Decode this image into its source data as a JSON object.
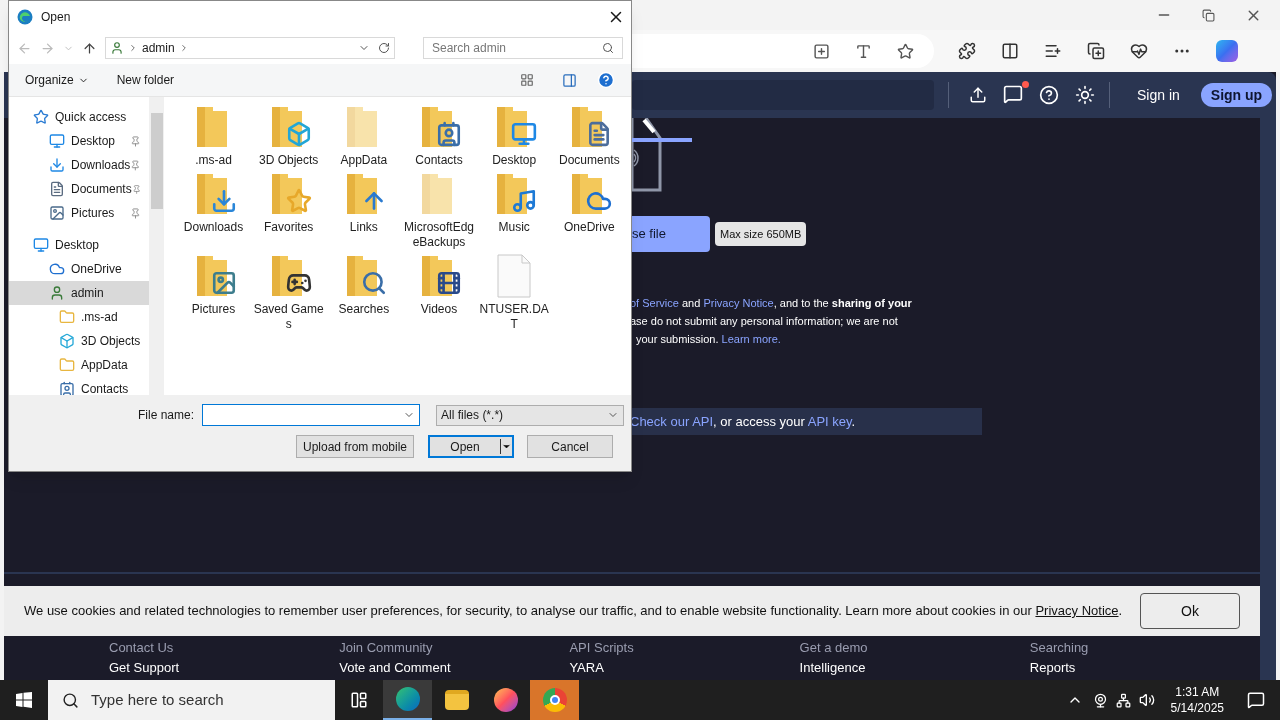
{
  "site": {
    "header": {
      "sign_in": "Sign in",
      "sign_up": "Sign up",
      "notification": true
    },
    "upload_button": "se file",
    "tooltip": "Max size 650MB",
    "terms_lines": [
      [
        {
          "kind": "link",
          "text": "of Service"
        },
        {
          "kind": "text",
          "text": " and "
        },
        {
          "kind": "link",
          "text": "Privacy Notice"
        },
        {
          "kind": "text",
          "text": ", and to the "
        },
        {
          "kind": "bold",
          "text": "sharing of your"
        }
      ],
      [
        {
          "kind": "text",
          "text": "ase do not submit any personal information; we are not"
        }
      ],
      [
        {
          "kind": "text",
          "text": "your submission. "
        },
        {
          "kind": "link",
          "text": "Learn more."
        }
      ]
    ],
    "api_bar": [
      {
        "kind": "link",
        "text": "Check our API"
      },
      {
        "kind": "text",
        "text": ", or access your "
      },
      {
        "kind": "link",
        "text": "API key"
      },
      {
        "kind": "text",
        "text": "."
      }
    ],
    "footer_rows": [
      [
        "Contact Us",
        "Join Community",
        "API Scripts",
        "Get a demo",
        "Searching"
      ],
      [
        "Get Support",
        "Vote and Comment",
        "YARA",
        "Intelligence",
        "Reports"
      ]
    ]
  },
  "cookie_banner": {
    "text": "We use cookies and related technologies to remember user preferences, for security, to analyse our traffic, and to enable website functionality. Learn more about cookies in our ",
    "link": "Privacy Notice",
    "end": ".",
    "button": "Ok"
  },
  "dialog": {
    "title": "Open",
    "path": "admin",
    "search": {
      "placeholder": "Search admin"
    },
    "toolbar": {
      "organize": "Organize",
      "new_folder": "New folder"
    },
    "tree": [
      {
        "label": "Quick access",
        "kind": "star",
        "selected": false,
        "children": [
          {
            "label": "Desktop",
            "kind": "desktop",
            "pinned": true,
            "selected": false
          },
          {
            "label": "Downloads",
            "kind": "download",
            "pinned": true,
            "selected": false
          },
          {
            "label": "Documents",
            "kind": "document",
            "pinned": true,
            "selected": false
          },
          {
            "label": "Pictures",
            "kind": "picture",
            "pinned": true,
            "selected": false
          }
        ]
      },
      {
        "label": "Desktop",
        "kind": "desktop",
        "selected": false,
        "children": [
          {
            "label": "OneDrive",
            "kind": "cloud",
            "selected": false
          },
          {
            "label": "admin",
            "kind": "user",
            "selected": true,
            "children": [
              {
                "label": ".ms-ad",
                "kind": "folder",
                "selected": false
              },
              {
                "label": "3D Objects",
                "kind": "cube",
                "selected": false
              },
              {
                "label": "AppData",
                "kind": "folder",
                "selected": false
              },
              {
                "label": "Contacts",
                "kind": "contacts",
                "selected": false
              }
            ]
          }
        ]
      }
    ],
    "files": [
      {
        "name": ".ms-ad",
        "kind": "plain",
        "hidden": false
      },
      {
        "name": "3D Objects",
        "kind": "cube",
        "hidden": false
      },
      {
        "name": "AppData",
        "kind": "plain",
        "hidden": true
      },
      {
        "name": "Contacts",
        "kind": "contacts",
        "hidden": false
      },
      {
        "name": "Desktop",
        "kind": "desktop",
        "hidden": false
      },
      {
        "name": "Documents",
        "kind": "documents",
        "hidden": false
      },
      {
        "name": "Downloads",
        "kind": "download",
        "hidden": false
      },
      {
        "name": "Favorites",
        "kind": "star",
        "hidden": false
      },
      {
        "name": "Links",
        "kind": "link",
        "hidden": false
      },
      {
        "name": "MicrosoftEdgeBackups",
        "kind": "plain",
        "hidden": true
      },
      {
        "name": "Music",
        "kind": "music",
        "hidden": false
      },
      {
        "name": "OneDrive",
        "kind": "cloud",
        "hidden": false
      },
      {
        "name": "Pictures",
        "kind": "pictures",
        "hidden": false
      },
      {
        "name": "Saved Games",
        "kind": "games",
        "hidden": false
      },
      {
        "name": "Searches",
        "kind": "search",
        "hidden": false
      },
      {
        "name": "Videos",
        "kind": "video",
        "hidden": false
      },
      {
        "name": "NTUSER.DAT",
        "kind": "file",
        "hidden": false
      }
    ],
    "file_name_label": "File name:",
    "file_type": "All files (*.*)",
    "buttons": {
      "upload": "Upload from mobile",
      "open": "Open",
      "cancel": "Cancel"
    }
  },
  "taskbar": {
    "search": {
      "placeholder": "Type here to search"
    },
    "apps": [
      {
        "kind": "edge",
        "selected": true
      },
      {
        "kind": "explorer",
        "selected": false
      },
      {
        "kind": "firefox",
        "selected": false
      },
      {
        "kind": "chrome",
        "selected": false
      }
    ],
    "time": "1:31 AM",
    "date": "5/14/2025"
  }
}
